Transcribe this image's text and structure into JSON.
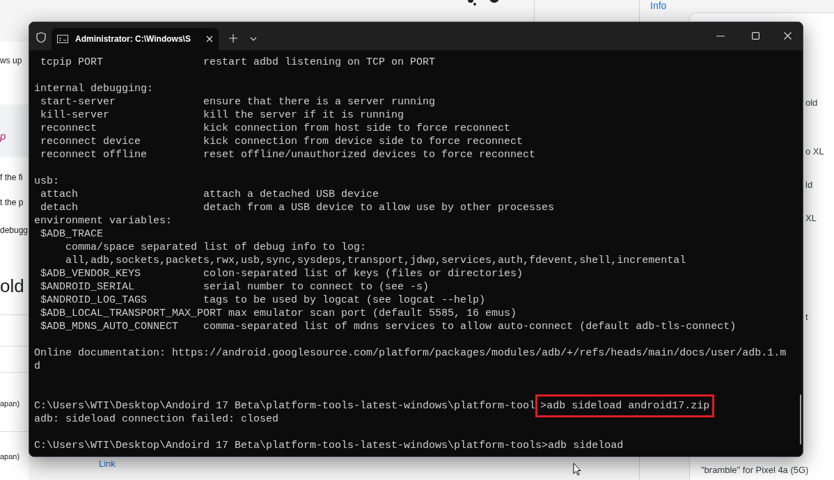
{
  "background_page": {
    "top_link": "Info",
    "left_fragments": [
      {
        "kind": "body",
        "text": "ws up"
      },
      {
        "kind": "link",
        "text": "p"
      },
      {
        "kind": "body",
        "text": "f the fi"
      },
      {
        "kind": "body",
        "text": "t the p"
      },
      {
        "kind": "body",
        "text": "debugg"
      },
      {
        "kind": "heading",
        "text": "old"
      },
      {
        "kind": "cell",
        "text": "apan)"
      },
      {
        "kind": "cell",
        "text": "apan)"
      }
    ],
    "table_link": "Link",
    "right_fragments": [
      "old",
      "o XL",
      "ld",
      "XL",
      "t"
    ],
    "caption": "\"bramble\" for Pixel 4a (5G)"
  },
  "terminal": {
    "tab_title": "Administrator: C:\\Windows\\S",
    "blocks": [
      {
        "wide_gap": false,
        "lines": [
          {
            "text": " tcpip PORT                restart adbd listening on TCP on PORT"
          }
        ]
      },
      {
        "wide_gap": false,
        "lines": [
          {
            "text": "internal debugging:"
          },
          {
            "text": " start-server              ensure that there is a server running"
          },
          {
            "text": " kill-server               kill the server if it is running"
          },
          {
            "text": " reconnect                 kick connection from host side to force reconnect"
          },
          {
            "text": " reconnect device          kick connection from device side to force reconnect"
          },
          {
            "text": " reconnect offline         reset offline/unauthorized devices to force reconnect"
          }
        ]
      },
      {
        "wide_gap": false,
        "lines": [
          {
            "text": "usb:"
          },
          {
            "text": " attach                    attach a detached USB device"
          },
          {
            "text": " detach                    detach from a USB device to allow use by other processes"
          },
          {
            "text": "environment variables:"
          },
          {
            "text": " $ADB_TRACE"
          },
          {
            "text": "     comma/space separated list of debug info to log:"
          },
          {
            "text": "     all,adb,sockets,packets,rwx,usb,sync,sysdeps,transport,jdwp,services,auth,fdevent,shell,incremental"
          },
          {
            "text": " $ADB_VENDOR_KEYS          colon-separated list of keys (files or directories)"
          },
          {
            "text": " $ANDROID_SERIAL           serial number to connect to (see -s)"
          },
          {
            "text": " $ANDROID_LOG_TAGS         tags to be used by logcat (see logcat --help)"
          },
          {
            "text": " $ADB_LOCAL_TRANSPORT_MAX_PORT max emulator scan port (default 5585, 16 emus)"
          },
          {
            "text": " $ADB_MDNS_AUTO_CONNECT    comma-separated list of mdns services to allow auto-connect (default adb-tls-connect)"
          }
        ]
      },
      {
        "wide_gap": true,
        "lines": [
          {
            "text": "Online documentation: https://android.googlesource.com/platform/packages/modules/adb/+/refs/heads/main/docs/user/adb.1.m"
          },
          {
            "text": "d"
          }
        ]
      },
      {
        "wide_gap": false,
        "lines": [
          {
            "text": "C:\\Users\\WTI\\Desktop\\Andoird 17 Beta\\platform-tools-latest-windows\\platform-tool",
            "highlight": ">adb sideload android17.zip"
          },
          {
            "text": "adb: sideload connection failed: closed"
          }
        ]
      },
      {
        "wide_gap": false,
        "lines": [
          {
            "text": "C:\\Users\\WTI\\Desktop\\Andoird 17 Beta\\platform-tools-latest-windows\\platform-tools>adb sideload"
          }
        ]
      }
    ]
  }
}
